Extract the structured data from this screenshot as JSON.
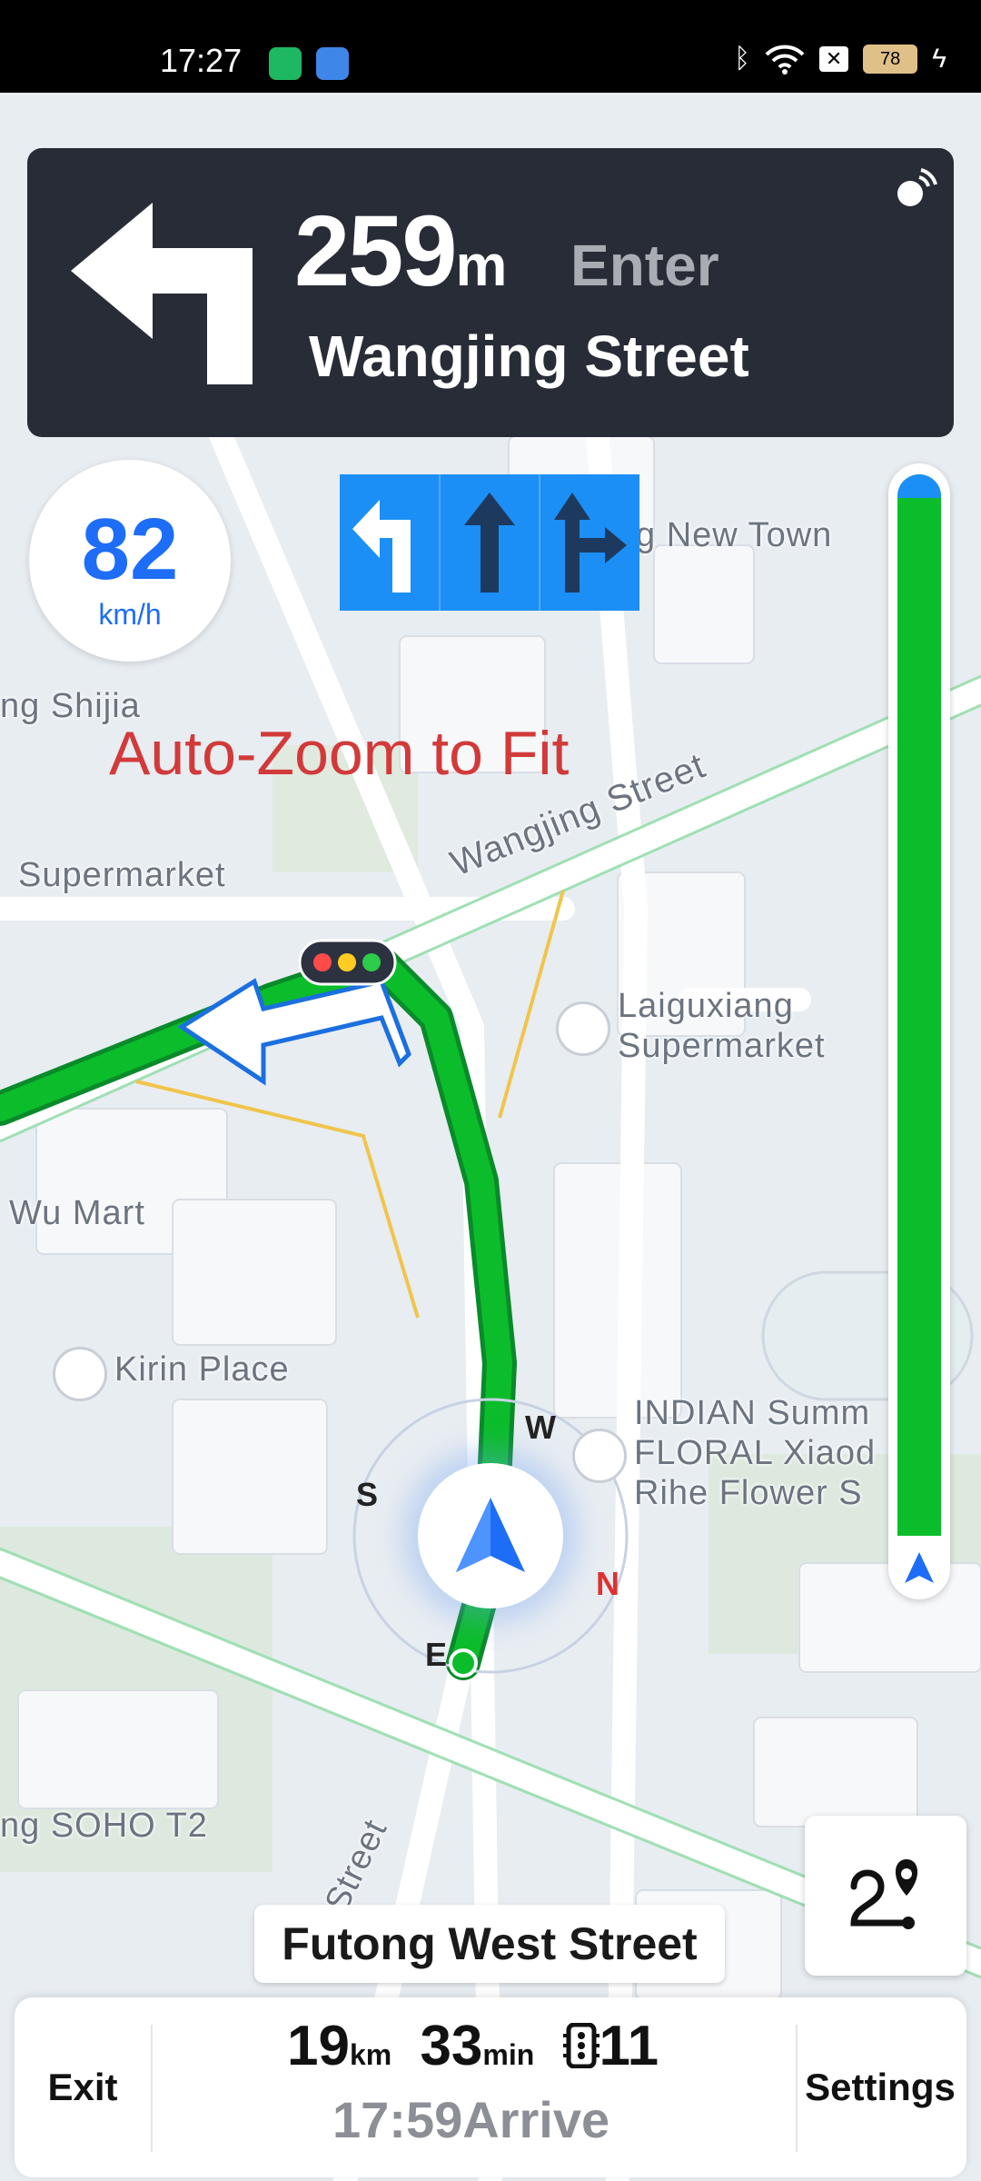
{
  "status_bar": {
    "time": "17:27",
    "battery": "78",
    "icons": [
      "shield-app-icon",
      "weather-app-icon",
      "bluetooth-icon",
      "wifi-icon",
      "sim-off-icon",
      "battery-icon",
      "charging-icon"
    ]
  },
  "turn_instruction": {
    "distance": "259",
    "unit": "m",
    "action": "Enter",
    "street": "Wangjing Street",
    "arrow_icon": "turn-left-arrow-icon"
  },
  "speed": {
    "value": "82",
    "unit": "km/h"
  },
  "lanes": [
    {
      "icon": "lane-left-arrow-icon",
      "active": true
    },
    {
      "icon": "lane-straight-arrow-icon",
      "active": false
    },
    {
      "icon": "lane-straight-right-arrow-icon",
      "active": false
    }
  ],
  "overlay_text": "Auto-Zoom to Fit",
  "map_labels": {
    "new_town": "g New Town",
    "shijia": "ng Shijia",
    "supermarket_left": "Supermarket",
    "wangjing_street": "Wangjing Street",
    "laiguxiang_1": "Laiguxiang",
    "laiguxiang_2": "Supermarket",
    "wu_mart": "Wu Mart",
    "kirin_place": "Kirin Place",
    "indian_1": "INDIAN Summ",
    "indian_2": "FLORAL Xiaod",
    "indian_3": "Rihe Flower S",
    "soho": "ng SOHO T2",
    "street_bottom": "Street"
  },
  "compass": {
    "n": "N",
    "e": "E",
    "s": "S",
    "w": "W"
  },
  "current_road": "Futong West Street",
  "bottom_panel": {
    "exit_label": "Exit",
    "settings_label": "Settings",
    "distance_value": "19",
    "distance_unit": "km",
    "time_value": "33",
    "time_unit": "min",
    "lights_count": "11",
    "arrive_time": "17:59",
    "arrive_label": "Arrive"
  },
  "colors": {
    "route_green": "#0bbd2a",
    "accent_blue": "#1e6df6",
    "panel_dark": "#282c36",
    "lane_blue": "#1b8ff5"
  }
}
